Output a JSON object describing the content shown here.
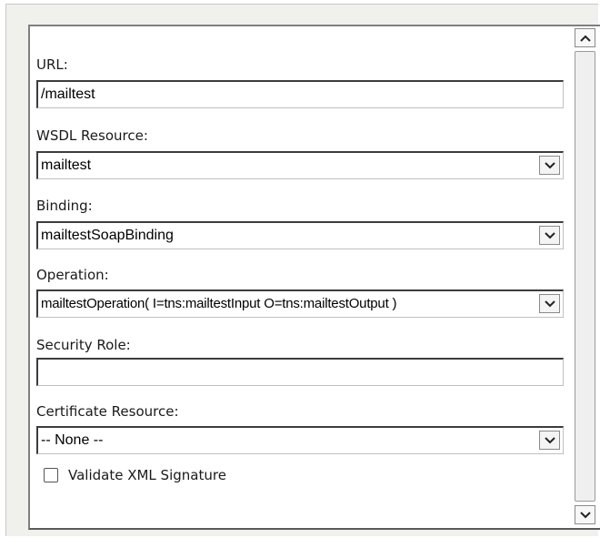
{
  "form": {
    "url": {
      "label": "URL:",
      "value": "/mailtest"
    },
    "wsdl": {
      "label": "WSDL Resource:",
      "value": "mailtest"
    },
    "binding": {
      "label": "Binding:",
      "value": "mailtestSoapBinding"
    },
    "operation": {
      "label": "Operation:",
      "value": "mailtestOperation( I=tns:mailtestInput O=tns:mailtestOutput )"
    },
    "security": {
      "label": "Security Role:",
      "value": ""
    },
    "certificate": {
      "label": "Certificate Resource:",
      "value": "-- None --"
    },
    "validate": {
      "label": "Validate XML Signature",
      "checked": false
    }
  },
  "icons": {
    "dropdown": "chevron-down-icon",
    "scroll_up": "arrow-up-icon",
    "scroll_down": "arrow-down-icon"
  }
}
